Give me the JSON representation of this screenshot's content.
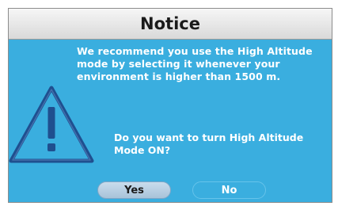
{
  "dialog": {
    "title": "Notice",
    "message": "We recommend you use the High Altitude mode by selecting it whenever your environment is higher than 1500 m.",
    "question": "Do you want to turn High Altitude Mode ON?",
    "icon": "warning-icon"
  },
  "buttons": {
    "yes_label": "Yes",
    "no_label": "No"
  },
  "colors": {
    "background": "#3aaedf",
    "title_bar": "#e6e6e6",
    "selected_button": "#b8d0e4",
    "text": "#ffffff"
  }
}
